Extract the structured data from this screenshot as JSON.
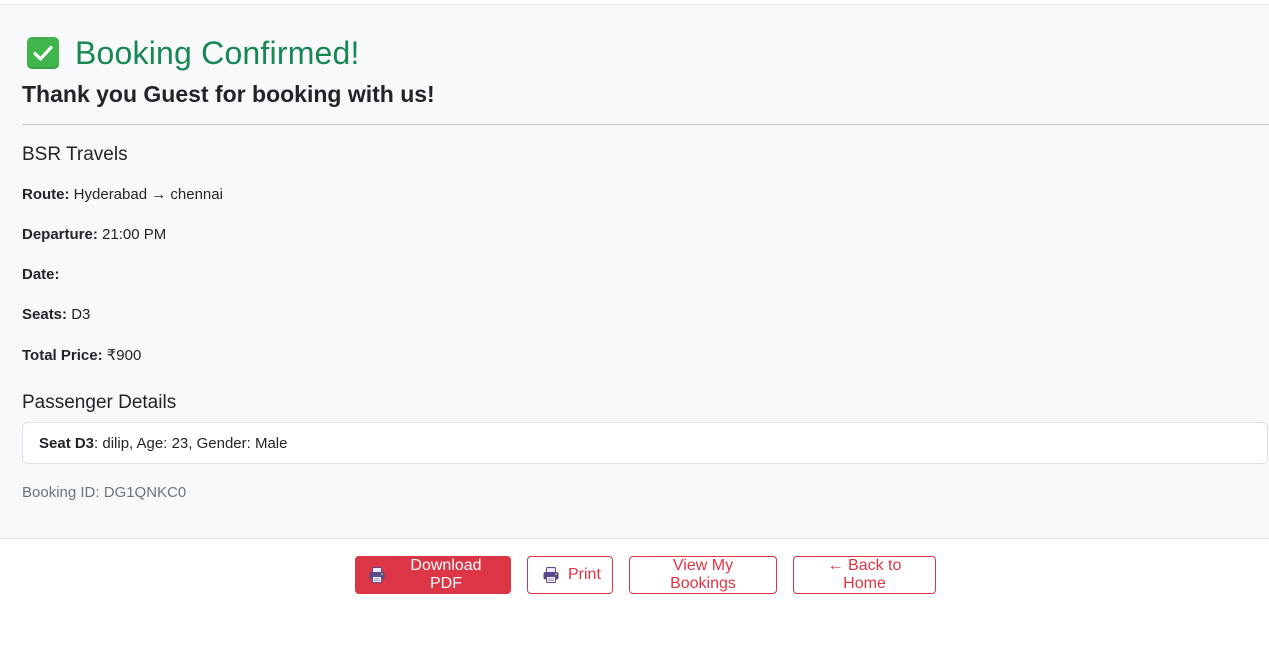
{
  "confirmation": {
    "title": "Booking Confirmed!",
    "icon": "check-mark-icon",
    "thanks": "Thank you Guest for booking with us!"
  },
  "trip": {
    "operator": "BSR Travels",
    "route_label": "Route:",
    "route_value": "Hyderabad → chennai",
    "departure_label": "Departure:",
    "departure_value": "21:00 PM",
    "date_label": "Date:",
    "date_value": "",
    "seats_label": "Seats:",
    "seats_value": "D3",
    "total_label": "Total Price:",
    "total_value": "₹900"
  },
  "passengers": {
    "heading": "Passenger Details",
    "items": [
      {
        "seat": "Seat D3",
        "details": ": dilip, Age: 23, Gender: Male"
      }
    ]
  },
  "booking": {
    "id_text": "Booking ID: DG1QNKC0"
  },
  "actions": {
    "download_label": "Download PDF",
    "print_label": "Print",
    "view_bookings_label": "View My Bookings",
    "back_home_label": "← Back to Home"
  },
  "colors": {
    "success": "#198754",
    "accent": "#dc3545",
    "check_bg": "#3fb54b",
    "muted": "#6c757d"
  }
}
